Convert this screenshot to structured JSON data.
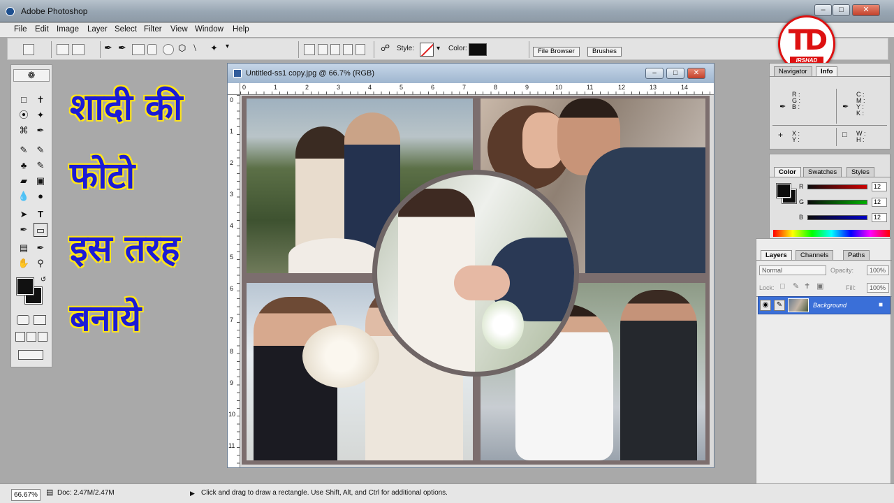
{
  "app": {
    "title": "Adobe Photoshop"
  },
  "menu": [
    "File",
    "Edit",
    "Image",
    "Layer",
    "Select",
    "Filter",
    "View",
    "Window",
    "Help"
  ],
  "options": {
    "style_label": "Style:",
    "color_label": "Color:",
    "color_value": "#0d0d0d",
    "well_tabs": [
      "File Browser",
      "Brushes"
    ]
  },
  "logo": {
    "letters": "TD",
    "name": "IRSHAD"
  },
  "overlay_text": [
    "शादी की",
    "फोटो",
    "इस तरह",
    "बनाये"
  ],
  "document": {
    "title": "Untitled-ss1 copy.jpg @ 66.7% (RGB)",
    "ruler_h": [
      "0",
      "1",
      "2",
      "3",
      "4",
      "5",
      "6",
      "7",
      "8",
      "9",
      "10",
      "11",
      "12",
      "13",
      "14"
    ],
    "ruler_v": [
      "0",
      "1",
      "2",
      "3",
      "4",
      "5",
      "6",
      "7",
      "8",
      "9",
      "10",
      "11"
    ]
  },
  "navigator_panel": {
    "tabs": [
      "Navigator",
      "Info"
    ],
    "rgb_labels": "R :\nG :\nB :",
    "cmyk_labels": "C :\nM :\nY :\nK :",
    "xy_labels": "X :\nY :",
    "wh_labels": "W :\nH :"
  },
  "color_panel": {
    "tabs": [
      "Color",
      "Swatches",
      "Styles"
    ],
    "channels": [
      {
        "label": "R",
        "value": "12",
        "color": "#c00000"
      },
      {
        "label": "G",
        "value": "12",
        "color": "#00a000"
      },
      {
        "label": "B",
        "value": "12",
        "color": "#0000c0"
      }
    ]
  },
  "layers_panel": {
    "tabs": [
      "Layers",
      "Channels",
      "Paths"
    ],
    "blend_mode": "Normal",
    "opacity_label": "Opacity:",
    "opacity_value": "100%",
    "lock_label": "Lock:",
    "fill_label": "Fill:",
    "fill_value": "100%",
    "layer_name": "Background"
  },
  "status": {
    "zoom": "66.67%",
    "doc_size": "Doc: 2.47M/2.47M",
    "hint": "Click and drag to draw a rectangle. Use Shift, Alt, and Ctrl for additional options."
  }
}
